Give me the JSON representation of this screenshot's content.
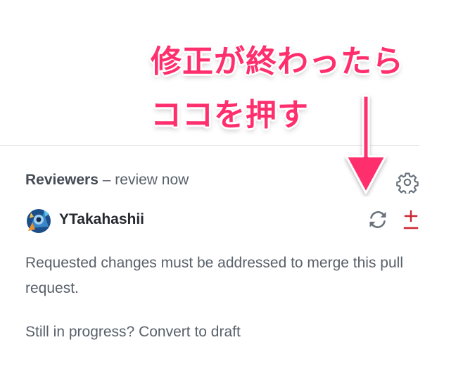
{
  "annotation": {
    "line1": "修正が終わったら",
    "line2": "ココを押す",
    "color": "#ff2f6d"
  },
  "reviewers": {
    "label": "Reviewers",
    "separator": " – ",
    "status": "review now",
    "settings_icon": "gear-icon",
    "reviewer": {
      "name": "YTakahashii",
      "rerequest_icon": "sync-icon",
      "status_icon": "changes-requested-icon"
    },
    "message": "Requested changes must be addressed to merge this pull request.",
    "draft_prefix": "Still in progress? ",
    "draft_link": "Convert to draft"
  },
  "colors": {
    "changes_requested": "#cb2431",
    "muted": "#586069",
    "icon": "#6a737d"
  }
}
